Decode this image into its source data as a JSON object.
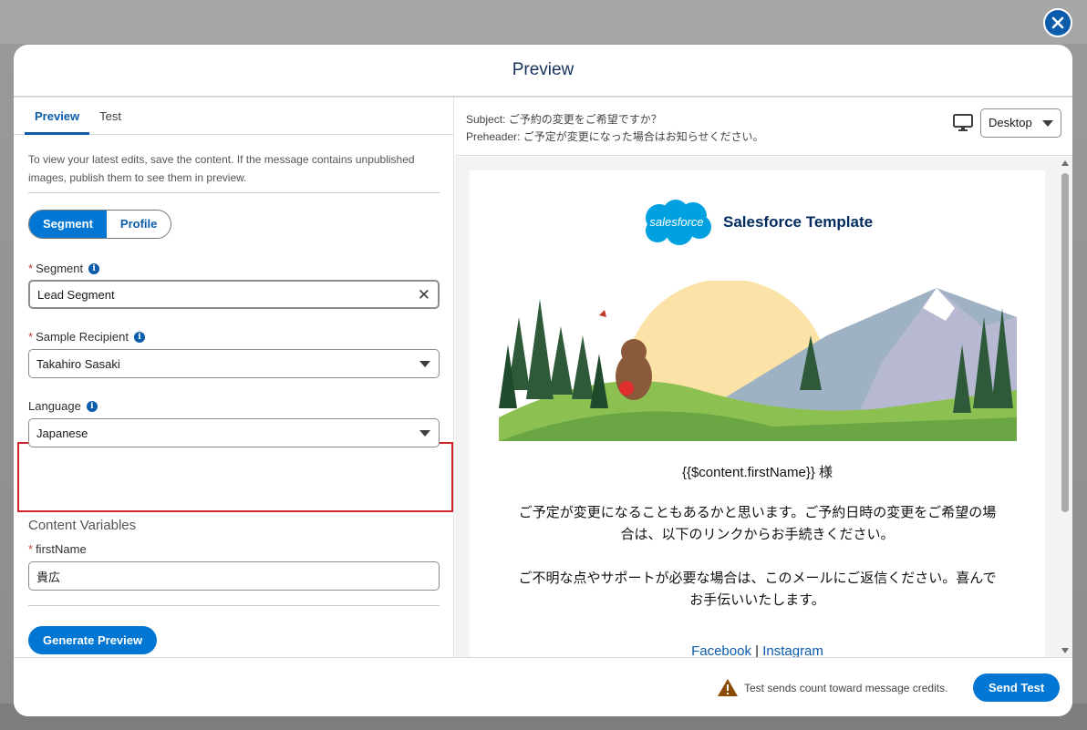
{
  "modal": {
    "title": "Preview"
  },
  "tabs": [
    {
      "label": "Preview",
      "active": true
    },
    {
      "label": "Test",
      "active": false
    }
  ],
  "info_text": "To view your latest edits, save the content. If the message contains unpublished images, publish them to see them in preview.",
  "source_toggle": {
    "options": [
      "Segment",
      "Profile"
    ],
    "selected": "Segment"
  },
  "fields": {
    "segment": {
      "label": "Segment",
      "required": true,
      "value": "Lead Segment"
    },
    "sample_recipient": {
      "label": "Sample Recipient",
      "required": true,
      "value": "Takahiro Sasaki"
    },
    "language": {
      "label": "Language",
      "required": false,
      "value": "Japanese"
    }
  },
  "content_variables": {
    "title": "Content Variables",
    "first_name": {
      "label": "firstName",
      "required": true,
      "value": "貴広"
    }
  },
  "generate_button": "Generate Preview",
  "preview": {
    "subject_label": "Subject:",
    "subject": "ご予約の変更をご希望ですか？",
    "preheader_label": "Preheader:",
    "preheader": "ご予定が変更になった場合はお知らせください。",
    "device": "Desktop"
  },
  "email": {
    "logo_text": "salesforce",
    "brand_name": "Salesforce Template",
    "greeting": "{{$content.firstName}} 様",
    "paragraph1_line1": "ご予定が変更になることもあるかと思います。ご予約日時の変更をご希望の場",
    "paragraph1_line2": "合は、以下のリンクからお手続きください。",
    "paragraph2_line1": "ご不明な点やサポートが必要な場合は、このメールにご返信ください。喜んで",
    "paragraph2_line2": "お手伝いいたします。",
    "link_facebook": "Facebook",
    "link_separator": "|",
    "link_instagram": "Instagram"
  },
  "footer": {
    "warning": "Test sends count toward message credits.",
    "send_button": "Send Test"
  },
  "colors": {
    "brand_blue": "#0176d3",
    "highlight_red": "#d1252c",
    "title_navy": "#16325c"
  }
}
